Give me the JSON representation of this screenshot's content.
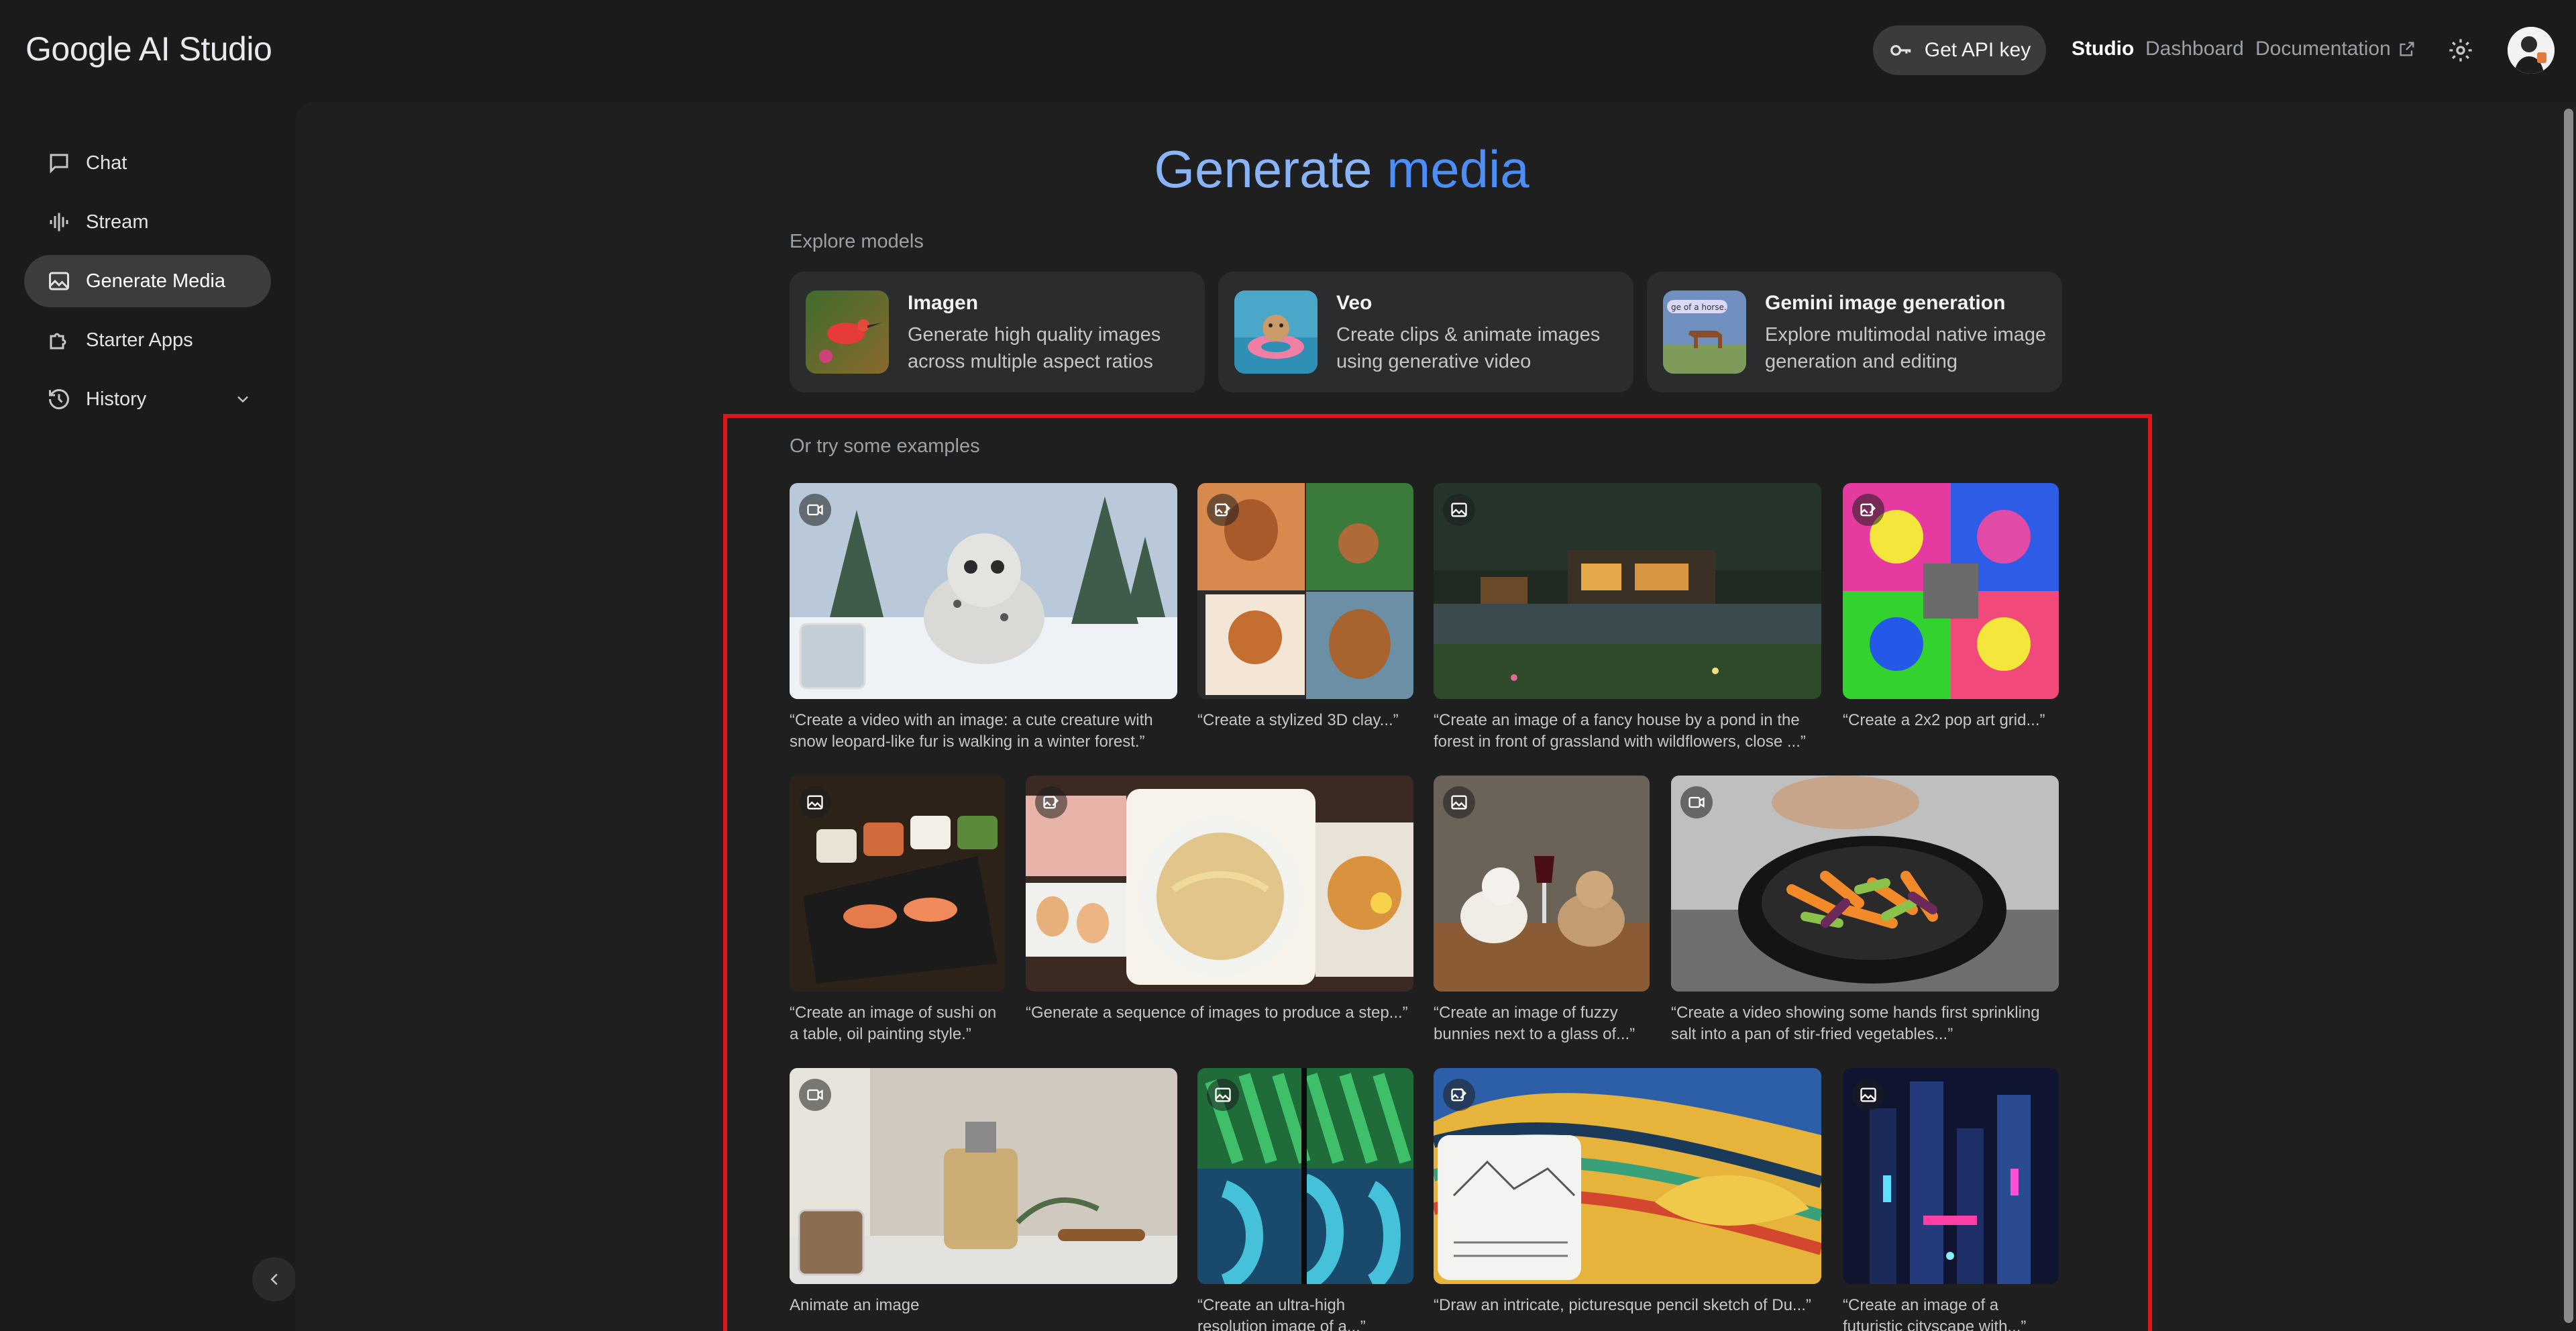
{
  "app": {
    "title": "Google AI Studio"
  },
  "header": {
    "api_key_label": "Get API key",
    "nav": {
      "studio": "Studio",
      "dashboard": "Dashboard",
      "documentation": "Documentation"
    }
  },
  "sidebar": {
    "items": [
      {
        "label": "Chat",
        "icon": "chat-icon"
      },
      {
        "label": "Stream",
        "icon": "stream-icon"
      },
      {
        "label": "Generate Media",
        "icon": "image-icon",
        "active": true
      },
      {
        "label": "Starter Apps",
        "icon": "puzzle-icon"
      },
      {
        "label": "History",
        "icon": "history-icon"
      }
    ]
  },
  "main": {
    "title_part1": "Generate ",
    "title_part2": "media",
    "explore_label": "Explore models",
    "models": [
      {
        "name": "Imagen",
        "desc": "Generate high quality images across multiple aspect ratios"
      },
      {
        "name": "Veo",
        "desc": "Create clips & animate images using generative video"
      },
      {
        "name": "Gemini image generation",
        "desc": "Explore multimodal native image generation and editing",
        "thumb_text": "ge of a horse."
      }
    ],
    "examples_label": "Or try some examples",
    "examples": [
      {
        "caption": "“Create a video with an image: a cute creature with snow leopard-like fur is walking in a winter forest.”",
        "type": "video"
      },
      {
        "caption": "“Create a stylized 3D clay...”",
        "type": "edit"
      },
      {
        "caption": "“Create an image of a fancy house by a pond in the forest in front of grassland with wildflowers, close ...”",
        "type": "image"
      },
      {
        "caption": "“Create a 2x2 pop art grid...”",
        "type": "edit"
      },
      {
        "caption": "“Create an image of sushi on a table, oil painting style.”",
        "type": "image"
      },
      {
        "caption": "“Generate a sequence of images to produce a step...”",
        "type": "edit"
      },
      {
        "caption": "“Create an image of fuzzy bunnies next to a glass of...”",
        "type": "image"
      },
      {
        "caption": "“Create a video showing some hands first sprinkling salt into a pan of stir-fried vegetables...”",
        "type": "video"
      },
      {
        "caption": "Animate an image",
        "type": "video"
      },
      {
        "caption": "“Create an ultra-high resolution image of a...”",
        "type": "image"
      },
      {
        "caption": "“Draw an intricate, picturesque pencil sketch of Du...”",
        "type": "edit"
      },
      {
        "caption": "“Create an image of a futuristic cityscape with...”",
        "type": "image"
      }
    ]
  },
  "colors": {
    "accent": "#4c8df6",
    "highlight": "#e0151b",
    "background": "#1b1b1b"
  }
}
